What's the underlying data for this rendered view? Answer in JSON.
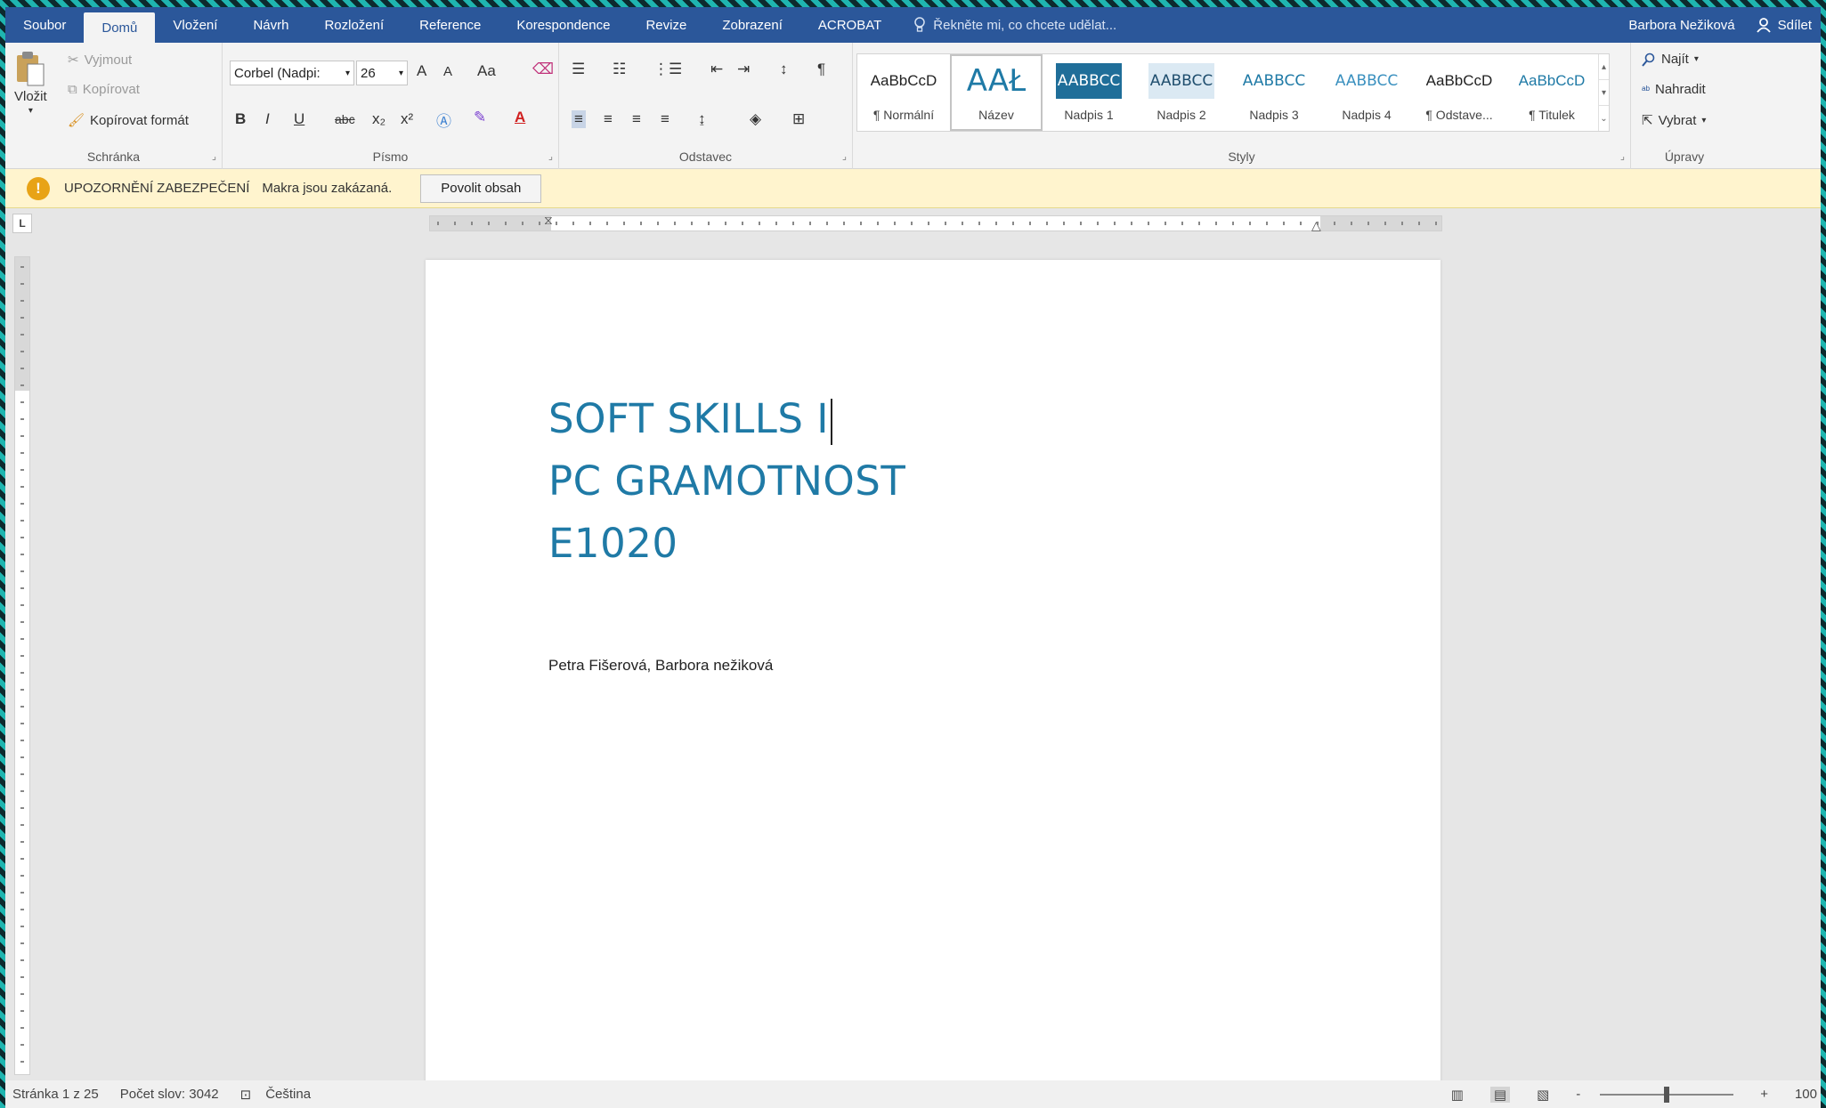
{
  "tabs": [
    "Soubor",
    "Domů",
    "Vložení",
    "Návrh",
    "Rozložení",
    "Reference",
    "Korespondence",
    "Revize",
    "Zobrazení",
    "ACROBAT"
  ],
  "active_tab_index": 1,
  "tell_me": "Řekněte mi, co chcete udělat...",
  "user_name": "Barbora Nežiková",
  "share_label": "Sdílet",
  "clipboard": {
    "paste": "Vložit",
    "cut": "Vyjmout",
    "copy": "Kopírovat",
    "format_painter": "Kopírovat formát",
    "label": "Schránka"
  },
  "font": {
    "name": "Corbel (Nadpi:",
    "size": "26",
    "label": "Písmo",
    "grow": "A",
    "shrink": "A",
    "case": "Aa",
    "bold": "B",
    "italic": "I",
    "underline": "U",
    "strike": "abc",
    "subscript": "x₂",
    "superscript": "x²"
  },
  "paragraph": {
    "label": "Odstavec",
    "pilcrow": "¶"
  },
  "styles": {
    "label": "Styly",
    "items": [
      {
        "sample": "AaBbCcD",
        "name": "¶ Normální"
      },
      {
        "sample": "AAŁ",
        "name": "Název"
      },
      {
        "sample": "AABBCC",
        "name": "Nadpis 1"
      },
      {
        "sample": "AABBCC",
        "name": "Nadpis 2"
      },
      {
        "sample": "AABBCC",
        "name": "Nadpis 3"
      },
      {
        "sample": "AABBCC",
        "name": "Nadpis 4"
      },
      {
        "sample": "AaBbCcD",
        "name": "¶ Odstave..."
      },
      {
        "sample": "AaBbCcD",
        "name": "¶ Titulek"
      }
    ],
    "selected_index": 1
  },
  "editing": {
    "find": "Najít",
    "replace": "Nahradit",
    "select": "Vybrat",
    "label": "Úpravy"
  },
  "security_bar": {
    "title": "UPOZORNĚNÍ ZABEZPEČENÍ",
    "message": "Makra jsou zakázaná.",
    "button": "Povolit obsah"
  },
  "ruler_corner": "L",
  "document": {
    "lines": [
      "SOFT SKILLS I",
      "PC GRAMOTNOST",
      "E1020"
    ],
    "authors": "Petra Fišerová, Barbora nežiková"
  },
  "status": {
    "page": "Stránka 1 z 25",
    "words": "Počet slov: 3042",
    "language": "Čeština",
    "zoom": "100",
    "zoom_minus": "-",
    "zoom_plus": "+"
  },
  "colors": {
    "accent": "#2b579a",
    "title_text": "#1f7aa6",
    "security_bar": "#fff4ce"
  }
}
